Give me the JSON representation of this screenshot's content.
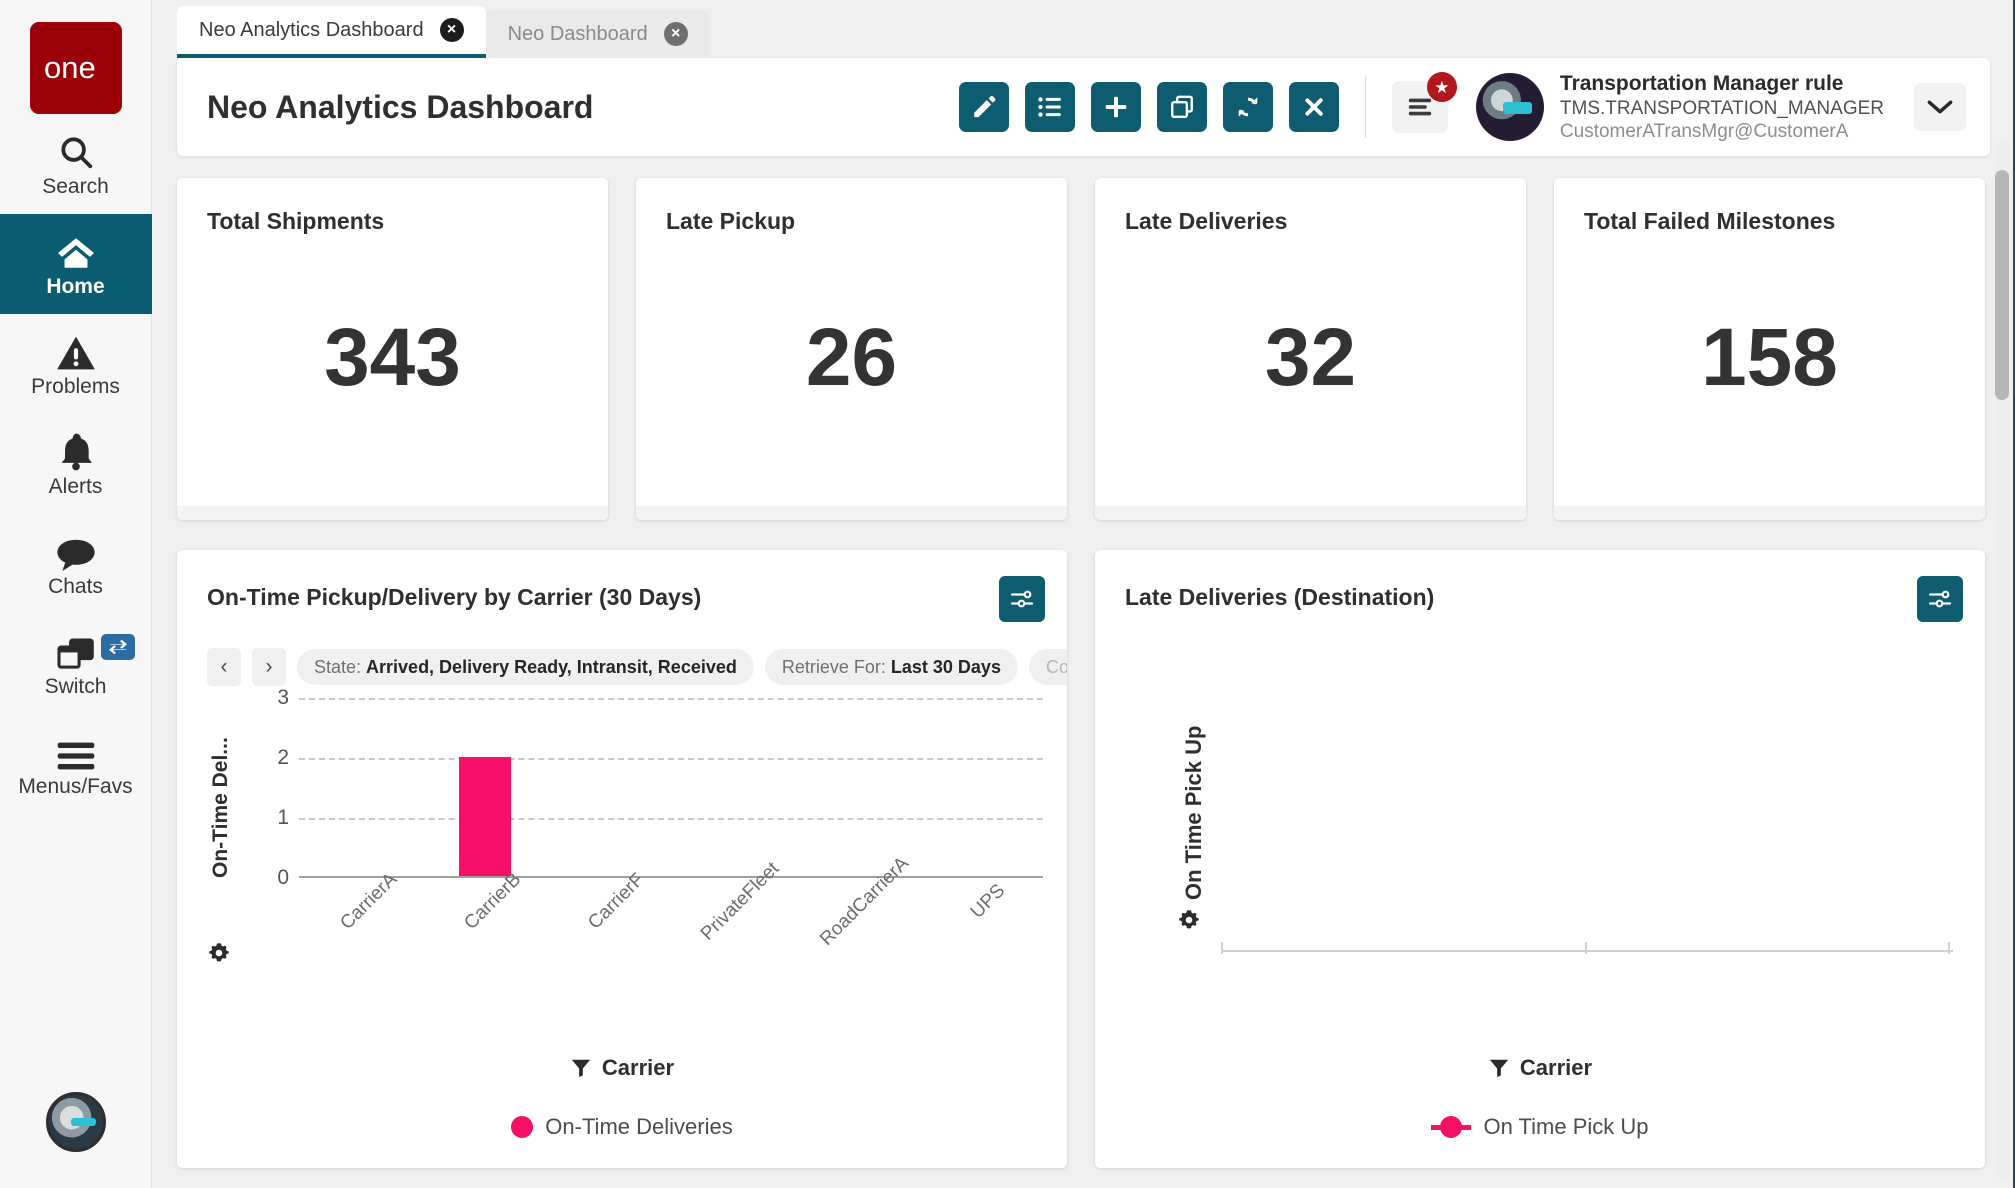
{
  "brand": {
    "logo_text": "one",
    "logo_color": "#9c0008"
  },
  "sidebar": {
    "items": [
      {
        "label": "Search",
        "icon": "search-icon",
        "active": false
      },
      {
        "label": "Home",
        "icon": "home-icon",
        "active": true
      },
      {
        "label": "Problems",
        "icon": "warning-icon",
        "active": false
      },
      {
        "label": "Alerts",
        "icon": "bell-icon",
        "active": false
      },
      {
        "label": "Chats",
        "icon": "chat-icon",
        "active": false
      },
      {
        "label": "Switch",
        "icon": "switch-icon",
        "active": false
      },
      {
        "label": "Menus/Favs",
        "icon": "hamburger-icon",
        "active": false
      }
    ],
    "avatar_icon": "robot-avatar-icon"
  },
  "tabs": [
    {
      "label": "Neo Analytics Dashboard",
      "active": true,
      "close_label": "×"
    },
    {
      "label": "Neo Dashboard",
      "active": false,
      "close_label": "×"
    }
  ],
  "header": {
    "title": "Neo Analytics Dashboard",
    "toolbar": [
      {
        "name": "edit-button",
        "icon": "pencil-icon"
      },
      {
        "name": "list-button",
        "icon": "list-icon"
      },
      {
        "name": "add-button",
        "icon": "plus-icon"
      },
      {
        "name": "duplicate-button",
        "icon": "copy-icon"
      },
      {
        "name": "refresh-button",
        "icon": "refresh-icon"
      },
      {
        "name": "close-button",
        "icon": "close-icon"
      }
    ],
    "menu_badge": "★",
    "user": {
      "name": "Transportation Manager rule",
      "role": "TMS.TRANSPORTATION_MANAGER",
      "id": "CustomerATransMgr@CustomerA"
    },
    "accent_color": "#0e5c70"
  },
  "kpis": [
    {
      "title": "Total Shipments",
      "value": "343"
    },
    {
      "title": "Late Pickup",
      "value": "26"
    },
    {
      "title": "Late Deliveries",
      "value": "32"
    },
    {
      "title": "Total Failed Milestones",
      "value": "158"
    }
  ],
  "charts": [
    {
      "title": "On-Time Pickup/Delivery by Carrier (30 Days)",
      "filters": [
        {
          "label": "State:",
          "value": "Arrived, Delivery Ready, Intransit, Received",
          "truncated": false
        },
        {
          "label": "Retrieve For:",
          "value": "Last 30 Days",
          "truncated": false
        },
        {
          "label": "Cor",
          "value": "",
          "truncated": true
        }
      ],
      "nav_prev": "‹",
      "nav_next": "›"
    },
    {
      "title": "Late Deliveries (Destination)",
      "filters": [],
      "nav_prev": "",
      "nav_next": ""
    }
  ],
  "chart_data": [
    {
      "type": "bar",
      "title": "On-Time Pickup/Delivery by Carrier (30 Days)",
      "categories": [
        "CarrierA",
        "CarrierB",
        "CarrierF",
        "PrivateFleet",
        "RoadCarrierA",
        "UPS"
      ],
      "values": [
        0,
        2,
        0,
        0,
        0,
        0
      ],
      "series": [
        {
          "name": "On-Time Deliveries",
          "values": [
            0,
            2,
            0,
            0,
            0,
            0
          ],
          "color": "#f50f67"
        }
      ],
      "xlabel": "Carrier",
      "ylabel": "On-Time Del...",
      "ylim": [
        0,
        3
      ],
      "yticks": [
        "0",
        "1",
        "2",
        "3"
      ],
      "grid": true,
      "legend": [
        {
          "label": "On-Time Deliveries",
          "color": "#f50f67",
          "marker": "circle"
        }
      ],
      "legend_position": "bottom"
    },
    {
      "type": "line",
      "title": "Late Deliveries (Destination)",
      "categories": [],
      "values": [],
      "series": [
        {
          "name": "On Time Pick Up",
          "values": [],
          "color": "#f50f67"
        }
      ],
      "xlabel": "Carrier",
      "ylabel": "On Time Pick Up",
      "ylim": [
        0,
        0
      ],
      "yticks": [],
      "grid": false,
      "legend": [
        {
          "label": "On Time Pick Up",
          "color": "#f50f67",
          "marker": "line-circle"
        }
      ],
      "legend_position": "bottom"
    }
  ]
}
